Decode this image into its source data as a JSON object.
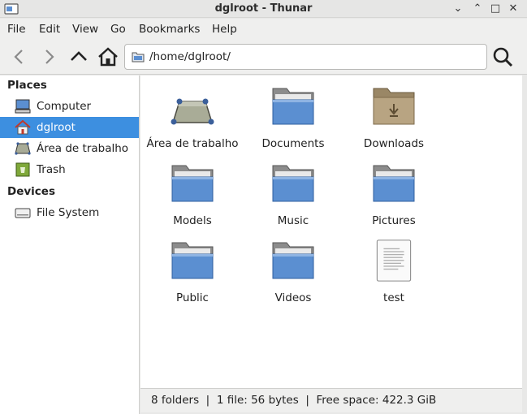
{
  "window": {
    "title": "dglroot - Thunar",
    "controls": [
      "⌄",
      "⌃",
      "□",
      "✕"
    ]
  },
  "menu": [
    "File",
    "Edit",
    "View",
    "Go",
    "Bookmarks",
    "Help"
  ],
  "toolbar": {
    "path": "/home/dglroot/"
  },
  "sidebar": {
    "places_heading": "Places",
    "devices_heading": "Devices",
    "places": [
      {
        "label": "Computer",
        "icon": "computer-icon",
        "selected": false
      },
      {
        "label": "dglroot",
        "icon": "home-icon",
        "selected": true
      },
      {
        "label": "Área de trabalho",
        "icon": "desktop-icon",
        "selected": false
      },
      {
        "label": "Trash",
        "icon": "trash-icon",
        "selected": false
      }
    ],
    "devices": [
      {
        "label": "File System",
        "icon": "drive-icon",
        "selected": false
      }
    ]
  },
  "files": [
    {
      "name": "Área de trabalho",
      "icon": "desktop-icon"
    },
    {
      "name": "Documents",
      "icon": "folder-icon"
    },
    {
      "name": "Downloads",
      "icon": "downloads-folder-icon"
    },
    {
      "name": "Models",
      "icon": "folder-icon"
    },
    {
      "name": "Music",
      "icon": "folder-icon"
    },
    {
      "name": "Pictures",
      "icon": "folder-icon"
    },
    {
      "name": "Public",
      "icon": "folder-icon"
    },
    {
      "name": "Videos",
      "icon": "folder-icon"
    },
    {
      "name": "test",
      "icon": "text-file-icon"
    }
  ],
  "status": "8 folders  |  1 file: 56 bytes  |  Free space: 422.3 GiB",
  "colors": {
    "selection": "#3d8fe0",
    "folder_blue": "#5b8fd1",
    "folder_grey": "#8c8c8c",
    "downloads_tan": "#b8a482"
  }
}
